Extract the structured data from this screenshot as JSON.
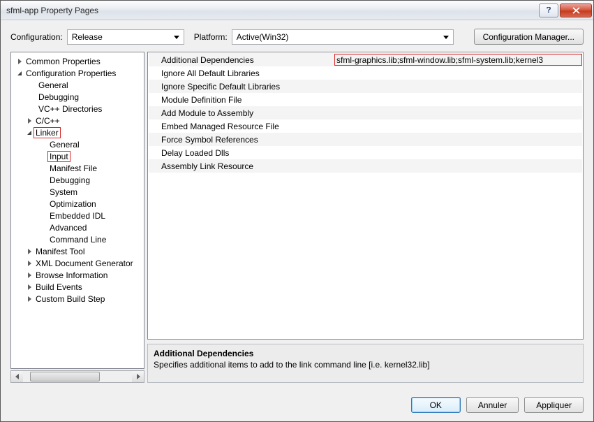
{
  "title": "sfml-app Property Pages",
  "config": {
    "label": "Configuration:",
    "value": "Release",
    "platform_label": "Platform:",
    "platform_value": "Active(Win32)",
    "manager_btn": "Configuration Manager..."
  },
  "tree": {
    "common_properties": "Common Properties",
    "configuration_properties": "Configuration Properties",
    "general": "General",
    "debugging": "Debugging",
    "vcpp_dirs": "VC++ Directories",
    "ccpp": "C/C++",
    "linker": "Linker",
    "linker_general": "General",
    "input": "Input",
    "manifest_file": "Manifest File",
    "linker_debugging": "Debugging",
    "system": "System",
    "optimization": "Optimization",
    "embedded_idl": "Embedded IDL",
    "advanced": "Advanced",
    "command_line": "Command Line",
    "manifest_tool": "Manifest Tool",
    "xml_doc": "XML Document Generator",
    "browse_info": "Browse Information",
    "build_events": "Build Events",
    "custom_build": "Custom Build Step"
  },
  "grid": [
    {
      "label": "Additional Dependencies",
      "value": "sfml-graphics.lib;sfml-window.lib;sfml-system.lib;kernel3",
      "highlighted": true
    },
    {
      "label": "Ignore All Default Libraries",
      "value": ""
    },
    {
      "label": "Ignore Specific Default Libraries",
      "value": ""
    },
    {
      "label": "Module Definition File",
      "value": ""
    },
    {
      "label": "Add Module to Assembly",
      "value": ""
    },
    {
      "label": "Embed Managed Resource File",
      "value": ""
    },
    {
      "label": "Force Symbol References",
      "value": ""
    },
    {
      "label": "Delay Loaded Dlls",
      "value": ""
    },
    {
      "label": "Assembly Link Resource",
      "value": ""
    }
  ],
  "desc": {
    "title": "Additional Dependencies",
    "text": "Specifies additional items to add to the link command line [i.e. kernel32.lib]"
  },
  "buttons": {
    "ok": "OK",
    "cancel": "Annuler",
    "apply": "Appliquer"
  }
}
